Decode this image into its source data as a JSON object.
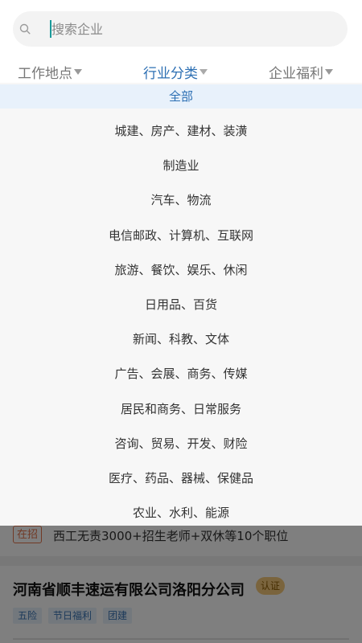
{
  "search": {
    "placeholder": "搜索企业",
    "value": ""
  },
  "filters": {
    "location": "工作地点",
    "industry": "行业分类",
    "benefits": "企业福利"
  },
  "industry_options": [
    "全部",
    "城建、房产、建材、装潢",
    "制造业",
    "汽车、物流",
    "电信邮政、计算机、互联网",
    "旅游、餐饮、娱乐、休闲",
    "日用品、百货",
    "新闻、科教、文体",
    "广告、会展、商务、传媒",
    "居民和商务、日常服务",
    "咨询、贸易、开发、财险",
    "医疗、药品、器械、保健品",
    "农业、水利、能源"
  ],
  "selected_index": 0,
  "job_card": {
    "hiring_badge": "在招",
    "hiring_text": "西工无责3000+招生老师+双休等10个职位",
    "company_name": "河南省顺丰速运有限公司洛阳分公司",
    "verify_badge": "认证",
    "tags": [
      "五险",
      "节日福利",
      "团建"
    ]
  },
  "colors": {
    "accent": "#2c6fb3",
    "selected_bg": "#e8f1fb",
    "hiring": "#e2724a",
    "verify": "#f5c97a"
  }
}
